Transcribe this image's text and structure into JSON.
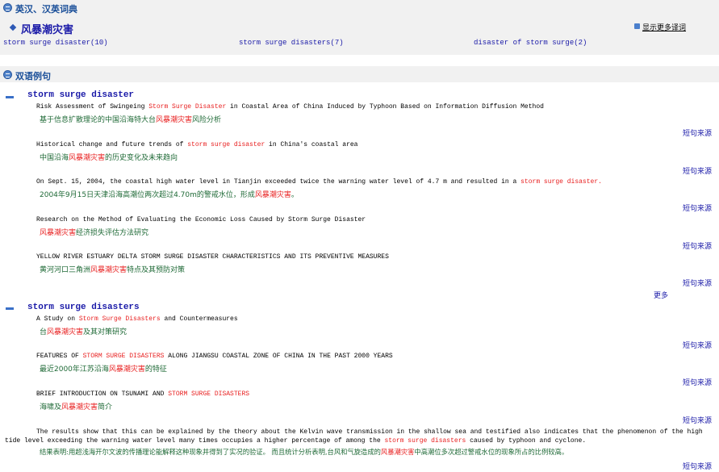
{
  "dictionary": {
    "section_title": "英汉、汉英词典",
    "headword": "风暴潮灾害",
    "more_definitions": "显示更多译词",
    "phrases": [
      "storm surge disaster(10)",
      "storm surge disasters(7)",
      "disaster of storm surge(2)"
    ]
  },
  "examples": {
    "section_title": "双语例句",
    "source_label": "短句来源",
    "more_label": "更多",
    "groups": [
      {
        "title": "storm surge disaster",
        "items": [
          {
            "en_pre": "Risk Assessment of Swingeing ",
            "en_hl": "Storm Surge Disaster",
            "en_post": " in Coastal Area of China Induced by Typhoon Based on Information Diffusion Method",
            "zh_pre": "基于信息扩散理论的中国沿海特大台",
            "zh_hl": "风暴潮灾害",
            "zh_post": "风险分析"
          },
          {
            "en_pre": "Historical change and future trends of ",
            "en_hl": "storm surge disaster",
            "en_post": " in China's coastal area",
            "zh_pre": "中国沿海",
            "zh_hl": "风暴潮灾害",
            "zh_post": "的历史变化及未来趋向"
          },
          {
            "en_pre": "On Sept. 15, 2004, the coastal high water level in Tianjin exceeded twice the warning water level of 4.7 m and resulted in a ",
            "en_hl": "storm surge disaster.",
            "en_post": "",
            "zh_pre": "2004年9月15日天津沿海高潮位两次超过4.70m的警戒水位，形成",
            "zh_hl": "风暴潮灾害",
            "zh_post": "。"
          },
          {
            "en_pre": "Research on the Method of Evaluating the Economic Loss Caused by Storm Surge Disaster",
            "en_hl": "",
            "en_post": "",
            "zh_pre": "",
            "zh_hl": "风暴潮灾害",
            "zh_post": "经济损失评估方法研究"
          },
          {
            "en_pre": "YELLOW RIVER ESTUARY DELTA STORM SURGE DISASTER CHARACTERISTICS AND ITS PREVENTIVE MEASURES",
            "en_hl": "",
            "en_post": "",
            "zh_pre": "黄河河口三角洲",
            "zh_hl": "风暴潮灾害",
            "zh_post": "特点及其预防对策"
          }
        ]
      },
      {
        "title": "storm surge disasters",
        "items": [
          {
            "en_pre": "A Study on ",
            "en_hl": "Storm Surge Disasters",
            "en_post": " and Countermeasures",
            "zh_pre": "台",
            "zh_hl": "风暴潮灾害",
            "zh_post": "及其对策研究"
          },
          {
            "en_pre": "FEATURES OF ",
            "en_hl": "STORM SURGE DISASTERS",
            "en_post": " ALONG JIANGSU COASTAL ZONE OF CHINA IN THE PAST 2000 YEARS",
            "zh_pre": "最近2000年江苏沿海",
            "zh_hl": "风暴潮灾害",
            "zh_post": "的特征"
          },
          {
            "en_pre": "BRIEF INTRODUCTION ON TSUNAMI AND ",
            "en_hl": "STORM SURGE DISASTERS",
            "en_post": "",
            "zh_pre": "海啸及",
            "zh_hl": "风暴潮灾害",
            "zh_post": "简介"
          },
          {
            "en_pre": "The results show that this can be explained by the theory about the Kelvin wave transmission in the shallow sea and testified also indicates that the phenomenon of the high tide level exceeding the warning water level many times occupies a higher percentage of among the ",
            "en_hl": "storm surge disasters",
            "en_post": " caused by typhoon and cyclone.",
            "zh_pre": "结果表明:用超浅海开尔文波的传播理论能解释这种现象并得到了实况的验证。 而且统计分析表明,台风和气旋造成的",
            "zh_hl": "风暴潮灾害",
            "zh_post": "中高潮位多次超过警戒水位的现象所占的比例较高。"
          }
        ]
      }
    ]
  }
}
